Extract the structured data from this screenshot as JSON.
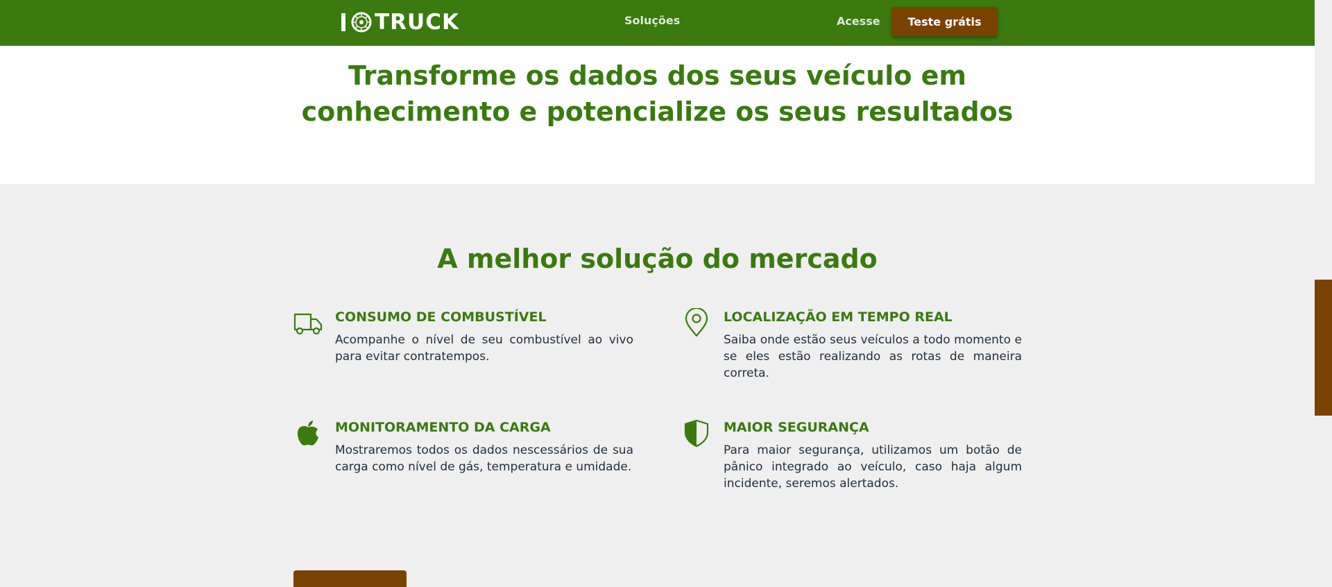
{
  "header": {
    "logo_text": "TRUCK",
    "nav": {
      "solucoes": "Soluções",
      "acesse": "Acesse",
      "cta": "Teste grátis"
    }
  },
  "hero": {
    "title_line1": "Transforme os dados dos seus veículo em",
    "title_line2": "conhecimento e potencialize os seus resultados"
  },
  "solutions": {
    "title": "A melhor solução do mercado",
    "features": [
      {
        "icon": "truck-icon",
        "title": "CONSUMO DE COMBUSTÍVEL",
        "description": "Acompanhe o nível de seu combustível ao vivo para evitar contratempos."
      },
      {
        "icon": "map-pin-icon",
        "title": "LOCALIZAÇÃO EM TEMPO REAL",
        "description": "Saiba onde estão seus veículos a todo momento e se eles estão realizando as rotas de maneira correta."
      },
      {
        "icon": "apple-icon",
        "title": "MONITORAMENTO DA CARGA",
        "description": "Mostraremos todos os dados nescessários de sua carga como nível de gás, temperatura e umidade."
      },
      {
        "icon": "shield-icon",
        "title": "MAIOR SEGURANÇA",
        "description": "Para maior segurança, utilizamos um botão de pânico integrado ao veículo, caso haja algum incidente, seremos alertados."
      }
    ]
  },
  "colors": {
    "brand_green": "#3a7a0f",
    "accent_brown": "#7a4200",
    "section_bg": "#efefef",
    "text_dark": "#222f3e"
  }
}
